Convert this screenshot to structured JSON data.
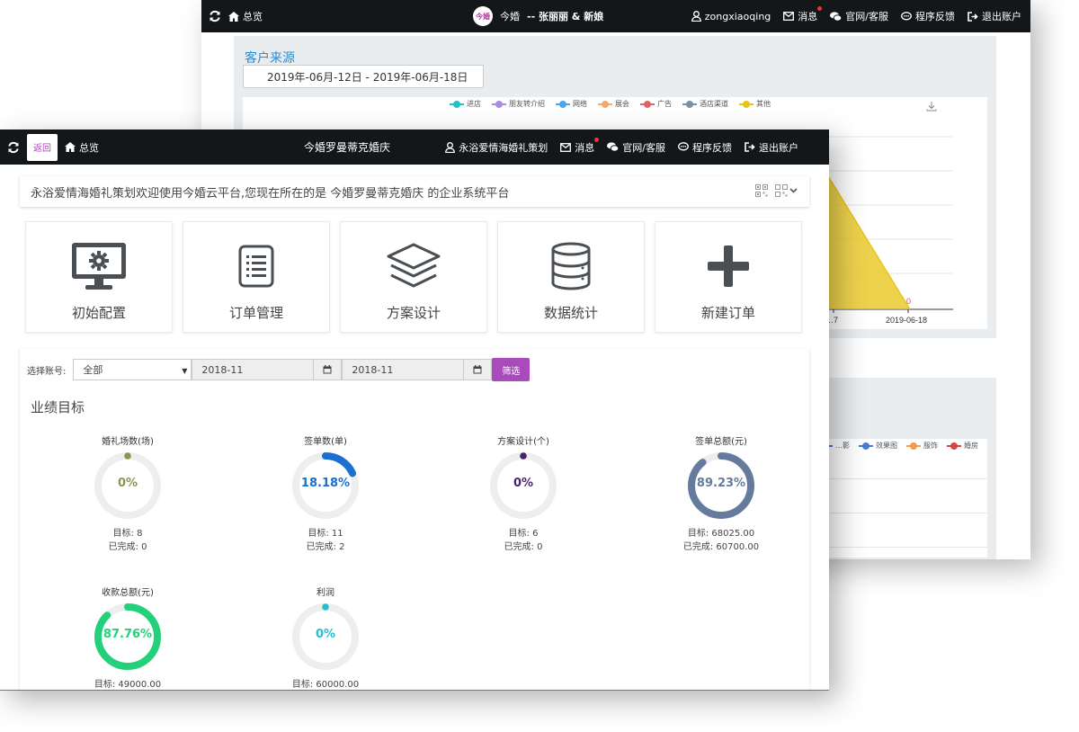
{
  "back_window": {
    "topbar": {
      "overview_label": "总览",
      "logo_text": "今婚",
      "app_name": "今婚",
      "couple": "-- 张丽丽 & 新娘",
      "username": "zongxiaoqing",
      "messages": "消息",
      "official": "官网/客服",
      "feedback": "程序反馈",
      "logout": "退出账户"
    },
    "panel": {
      "title": "客户来源",
      "date_range": "2019年-06月-12日 - 2019年-06月-18日"
    },
    "chart_data": {
      "type": "area",
      "title": "",
      "legend": [
        "进店",
        "朋友转介绍",
        "网络",
        "展会",
        "广告",
        "酒店渠道",
        "其他"
      ],
      "legend_colors": [
        "#22c3c6",
        "#a98ee0",
        "#4ea6ea",
        "#f5a86b",
        "#e06666",
        "#7f8fa6",
        "#e8c312"
      ],
      "x_ticks": [
        "…7",
        "2019-06-18"
      ],
      "last_value_label": "0",
      "series": [
        {
          "name": "其他",
          "x": [
            "2019-06-17",
            "2019-06-18"
          ],
          "values": [
            null,
            0
          ]
        }
      ]
    },
    "legend2": [
      "…影",
      "效果图",
      "服饰",
      "婚房"
    ],
    "legend2_colors": [
      "#4a7bd0",
      "#4a7bd0",
      "#f5994d",
      "#d64545"
    ]
  },
  "front_window": {
    "topbar": {
      "back_label": "返回",
      "overview_label": "总览",
      "store_name": "今婚罗曼蒂克婚庆",
      "account": "永浴爱情海婚礼策划",
      "messages": "消息",
      "official": "官网/客服",
      "feedback": "程序反馈",
      "logout": "退出账户"
    },
    "welcome": "永浴爱情海婚礼策划欢迎使用今婚云平台,您现在所在的是 今婚罗曼蒂克婚庆 的企业系统平台",
    "tiles": [
      {
        "label": "初始配置",
        "icon": "monitor-gear-icon"
      },
      {
        "label": "订单管理",
        "icon": "list-document-icon"
      },
      {
        "label": "方案设计",
        "icon": "layers-icon"
      },
      {
        "label": "数据统计",
        "icon": "database-icon"
      },
      {
        "label": "新建订单",
        "icon": "plus-icon"
      }
    ],
    "filter": {
      "account_label": "选择账号:",
      "account_value": "全部",
      "date_from": "2018-11",
      "date_to": "2018-11",
      "filter_button": "筛选"
    },
    "perf_title": "业绩目标",
    "gauges": [
      {
        "label": "婚礼场数(场)",
        "pct_text": "0%",
        "fraction": 0,
        "color": "#8f9550",
        "target_line": "目标:  8",
        "done_line": "已完成:  0"
      },
      {
        "label": "签单数(单)",
        "pct_text": "18.18%",
        "fraction": 0.1818,
        "color": "#1a6fd1",
        "target_line": "目标:  11",
        "done_line": "已完成:  2"
      },
      {
        "label": "方案设计(个)",
        "pct_text": "0%",
        "fraction": 0,
        "color": "#4a2270",
        "target_line": "目标:  6",
        "done_line": "已完成:  0"
      },
      {
        "label": "签单总额(元)",
        "pct_text": "89.23%",
        "fraction": 0.8923,
        "color": "#657a9c",
        "target_line": "目标:  68025.00",
        "done_line": "已完成:  60700.00"
      },
      {
        "label": "收款总额(元)",
        "pct_text": "87.76%",
        "fraction": 0.8776,
        "color": "#24d17a",
        "target_line": "目标:  49000.00",
        "done_line": ""
      },
      {
        "label": "利润",
        "pct_text": "0%",
        "fraction": 0,
        "color": "#22bfd0",
        "target_line": "目标:  60000.00",
        "done_line": ""
      }
    ]
  }
}
